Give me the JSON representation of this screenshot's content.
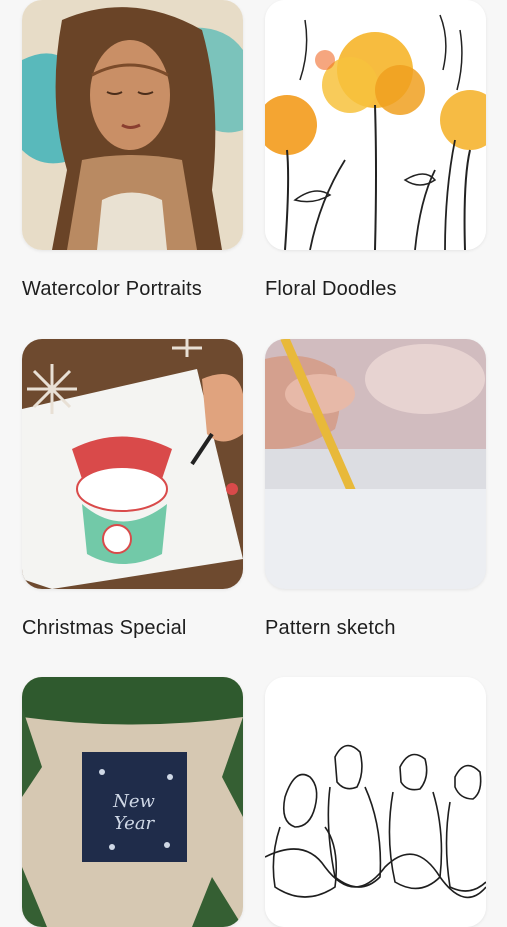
{
  "categories": [
    {
      "label": "Watercolor Portraits",
      "image": "watercolor-portrait-woman"
    },
    {
      "label": "Floral Doodles",
      "image": "orange-watercolor-flowers"
    },
    {
      "label": "Christmas Special",
      "image": "santa-drawing-with-snowflakes"
    },
    {
      "label": "Pattern sketch",
      "image": "hand-holding-pencil"
    },
    {
      "label": "",
      "image": "new-year-card-with-pine-branches"
    },
    {
      "label": "",
      "image": "line-drawing-of-friends"
    }
  ],
  "colors": {
    "background": "#f7f7f7",
    "label_text": "#1e1e1e"
  }
}
